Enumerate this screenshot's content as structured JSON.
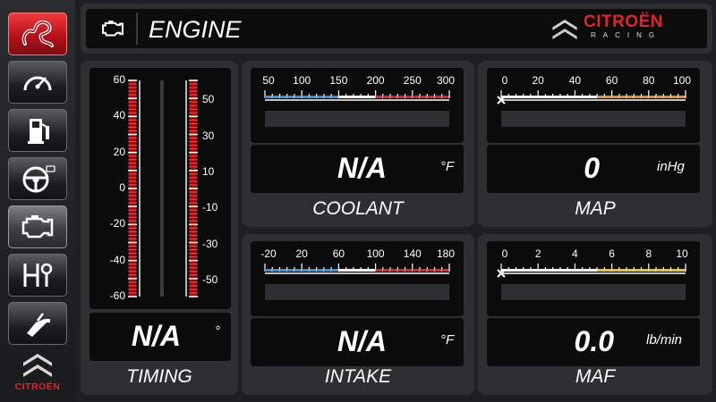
{
  "sidebar": {
    "items": [
      {
        "name": "racetrack",
        "state": "active-red"
      },
      {
        "name": "speedometer",
        "state": "normal"
      },
      {
        "name": "fuel",
        "state": "normal"
      },
      {
        "name": "steering",
        "state": "normal"
      },
      {
        "name": "engine",
        "state": "active-grey"
      },
      {
        "name": "gearbox",
        "state": "normal"
      },
      {
        "name": "fuel-nozzle",
        "state": "normal"
      }
    ],
    "logo_text": "CITROËN"
  },
  "header": {
    "icon": "engine-icon",
    "title": "ENGINE",
    "brand_name": "CITROËN",
    "brand_sub": "RACING"
  },
  "colors": {
    "accent_red": "#e0242c",
    "cold_blue": "#3a8fe0",
    "hot_red": "#e0242c",
    "orange": "#e8901c",
    "yellow": "#e8c21c"
  },
  "panels": {
    "timing": {
      "label": "TIMING",
      "value": "N/A",
      "unit": "°",
      "left_scale": [
        "60",
        "40",
        "20",
        "0",
        "-20",
        "-40",
        "-60"
      ],
      "right_scale": [
        "50",
        "30",
        "10",
        "-10",
        "-30",
        "-50"
      ]
    },
    "coolant": {
      "label": "COOLANT",
      "value": "N/A",
      "unit": "°F",
      "scale": [
        "50",
        "100",
        "150",
        "200",
        "250",
        "300"
      ]
    },
    "map": {
      "label": "MAP",
      "value": "0",
      "unit": "inHg",
      "scale": [
        "0",
        "20",
        "40",
        "60",
        "80",
        "100"
      ]
    },
    "intake": {
      "label": "INTAKE",
      "value": "N/A",
      "unit": "°F",
      "scale": [
        "-20",
        "20",
        "60",
        "100",
        "140",
        "180"
      ]
    },
    "maf": {
      "label": "MAF",
      "value": "0.0",
      "unit": "lb/min",
      "scale": [
        "0",
        "2",
        "4",
        "6",
        "8",
        "10"
      ]
    }
  }
}
